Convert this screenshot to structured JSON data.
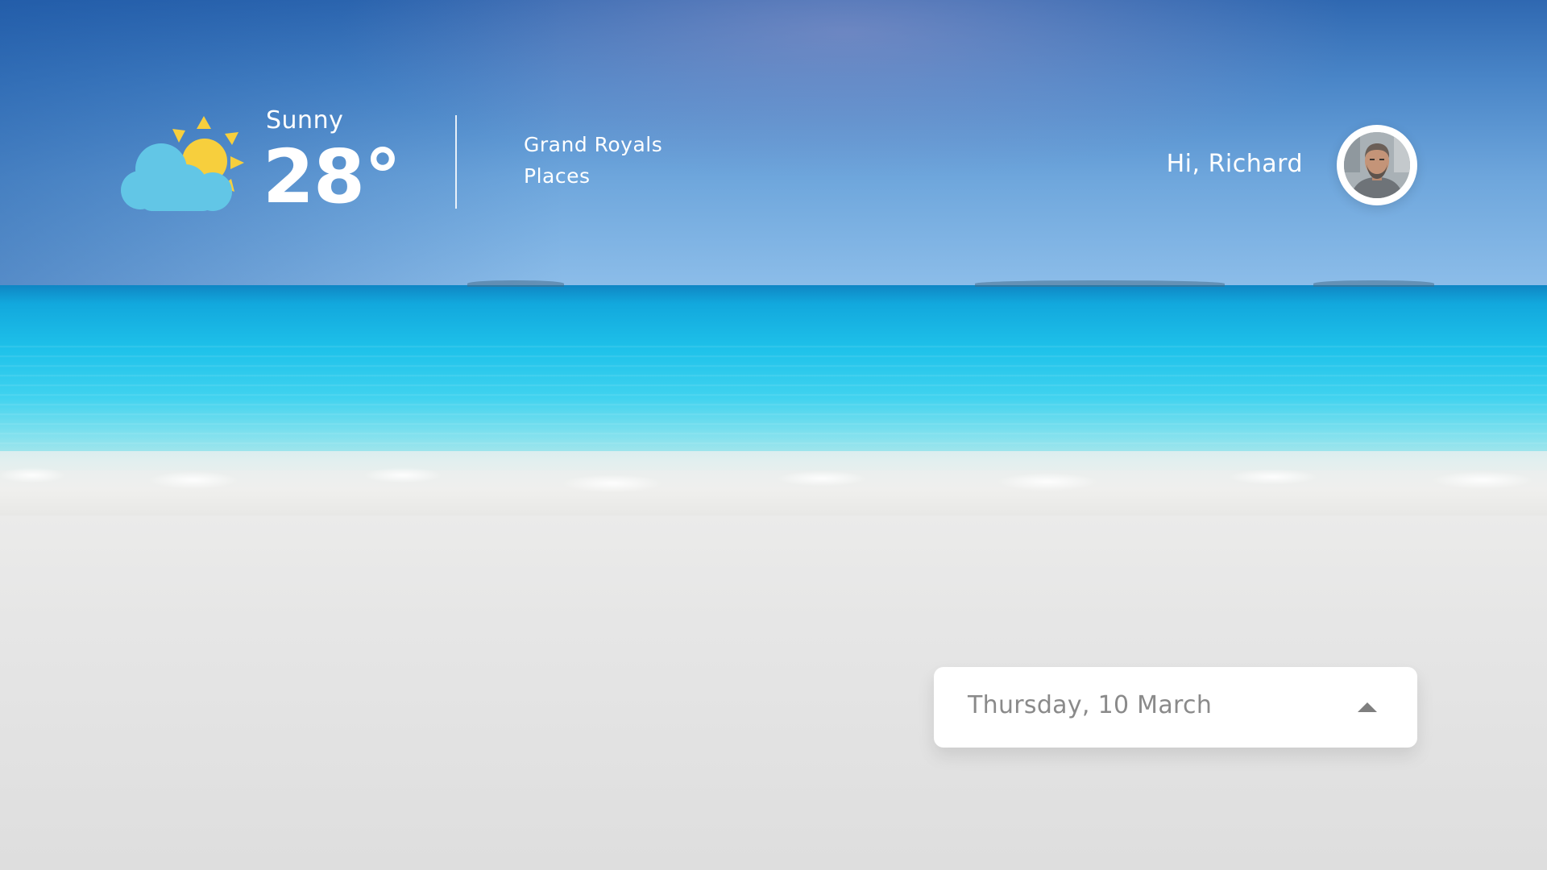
{
  "weather": {
    "condition": "Sunny",
    "temperature": "28°",
    "icon": "partly-sunny-cloud-icon",
    "sun_color": "#f7cf3d",
    "cloud_color": "#62c6e6"
  },
  "location": {
    "line1": "Grand Royals",
    "line2": "Places"
  },
  "user": {
    "greeting": "Hi, Richard",
    "avatar_icon": "user-avatar"
  },
  "date_select": {
    "value": "Thursday, 10 March",
    "caret_icon": "caret-up-icon"
  },
  "colors": {
    "sky": "#4a86c8",
    "sea": "#1fc2ea",
    "sand": "#e6e6e6",
    "text_light": "#ffffff",
    "text_muted": "#8a8a8a"
  }
}
